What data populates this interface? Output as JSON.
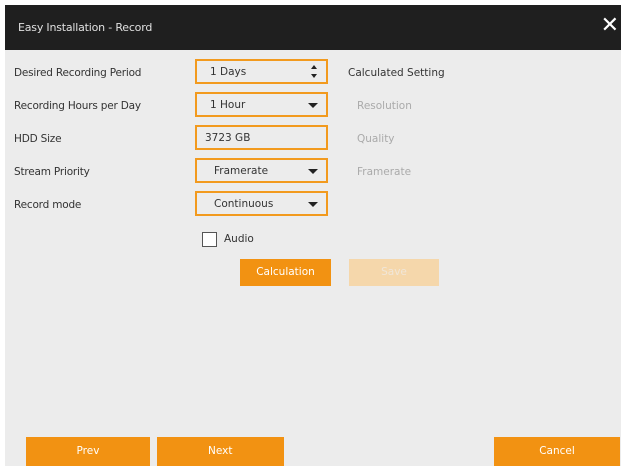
{
  "dialog": {
    "title": "Easy Installation - Record",
    "close_symbol": "✕"
  },
  "form": {
    "recording_period": {
      "label": "Desired Recording Period",
      "value": "1 Days"
    },
    "hours_per_day": {
      "label": "Recording Hours per Day",
      "value": "1 Hour"
    },
    "hdd_size": {
      "label": "HDD Size",
      "value": "3723 GB"
    },
    "stream_priority": {
      "label": "Stream Priority",
      "value": "Framerate"
    },
    "record_mode": {
      "label": "Record mode",
      "value": "Continuous"
    },
    "audio": {
      "label": "Audio",
      "checked": false
    }
  },
  "calculated": {
    "title": "Calculated Setting",
    "resolution": "Resolution",
    "quality": "Quality",
    "framerate": "Framerate"
  },
  "actions": {
    "calculation": "Calculation",
    "save": "Save"
  },
  "footer": {
    "prev": "Prev",
    "next": "Next",
    "cancel": "Cancel"
  },
  "colors": {
    "accent": "#f29212",
    "titlebar": "#1f1f1f",
    "background": "#ececec"
  }
}
